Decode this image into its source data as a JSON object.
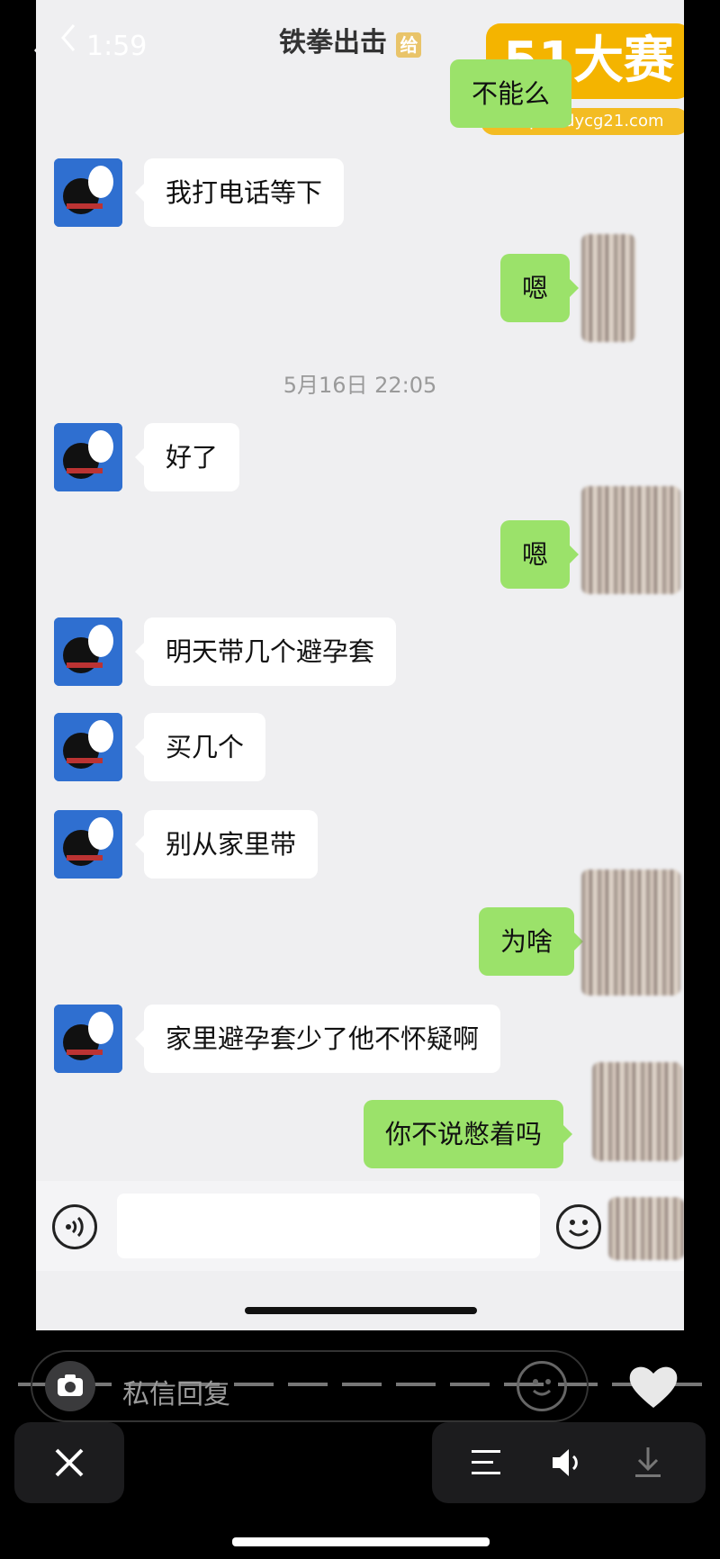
{
  "status_bar": {
    "time": "1:59"
  },
  "chat_header": {
    "title": "铁拳出击",
    "badge": "给"
  },
  "watermark": {
    "logo_text": "51大赛",
    "url": "https://dycg21.com"
  },
  "top_partial_out": "不能么",
  "timestamp": "5月16日 22:05",
  "messages": [
    {
      "dir": "in",
      "text": "我打电话等下"
    },
    {
      "dir": "out",
      "text": "嗯"
    },
    {
      "dir": "in",
      "text": "好了"
    },
    {
      "dir": "out",
      "text": "嗯"
    },
    {
      "dir": "in",
      "text": "明天带几个避孕套"
    },
    {
      "dir": "in",
      "text": "买几个"
    },
    {
      "dir": "in",
      "text": "别从家里带"
    },
    {
      "dir": "out",
      "text": "为啥"
    },
    {
      "dir": "in",
      "text": "家里避孕套少了他不怀疑啊"
    },
    {
      "dir": "out",
      "text": "你不说憋着吗"
    }
  ],
  "reply_bar": {
    "placeholder": "私信回复"
  },
  "icons": [
    "back-icon",
    "voice-icon",
    "emoji-icon",
    "camera-icon",
    "heart-icon",
    "close-icon",
    "menu-icon",
    "speaker-icon",
    "download-icon"
  ],
  "colors": {
    "outgoing_bubble": "#9be26a",
    "incoming_bubble": "#ffffff",
    "chat_bg": "#efeff1",
    "watermark": "#f4b400"
  }
}
